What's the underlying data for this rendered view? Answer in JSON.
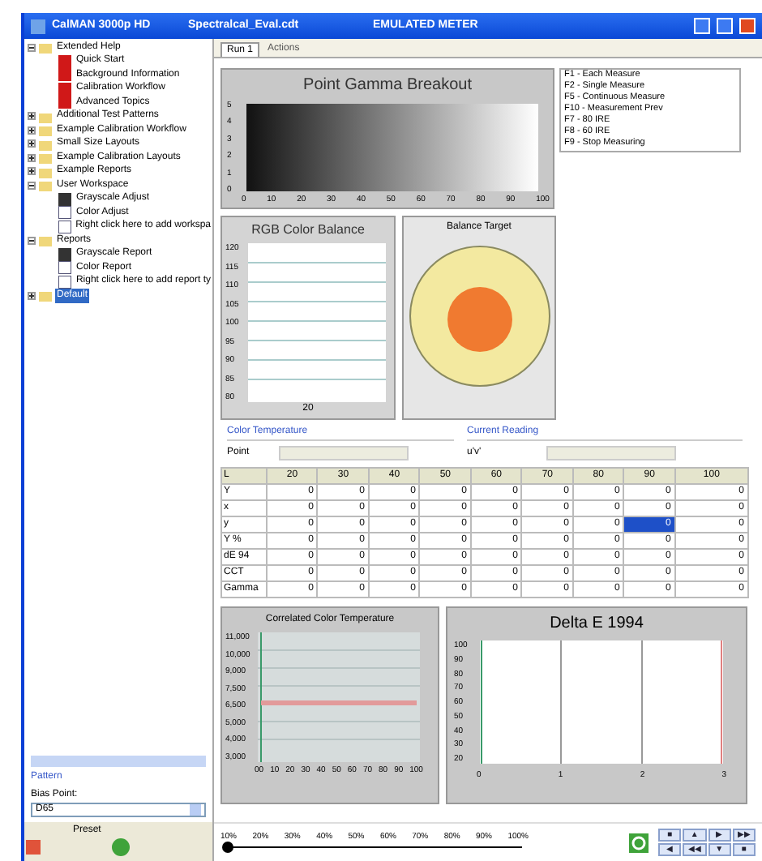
{
  "window": {
    "title": "CalMAN 3000p HD",
    "file": "Spectralcal_Eval.cdt",
    "meter": "EMULATED METER"
  },
  "tree": [
    {
      "label": "Extended Help",
      "kind": "folder",
      "expanded": true,
      "selected": false,
      "children": [
        {
          "label": "Quick Start",
          "kind": "book",
          "selected": false
        },
        {
          "label": "Background Information",
          "kind": "book",
          "selected": false
        },
        {
          "label": "Calibration Workflow",
          "kind": "book",
          "selected": false
        },
        {
          "label": "Advanced Topics",
          "kind": "book",
          "selected": false
        }
      ]
    },
    {
      "label": "Additional Test Patterns",
      "kind": "folder",
      "expanded": false,
      "selected": false
    },
    {
      "label": "Example Calibration Workflow",
      "kind": "folder",
      "expanded": false,
      "selected": false
    },
    {
      "label": "Small Size Layouts",
      "kind": "folder",
      "expanded": false,
      "selected": false
    },
    {
      "label": "Example Calibration Layouts",
      "kind": "folder",
      "expanded": false,
      "selected": false
    },
    {
      "label": "Example Reports",
      "kind": "folder",
      "expanded": false,
      "selected": false
    },
    {
      "label": "User Workspace",
      "kind": "folder",
      "expanded": true,
      "selected": false,
      "children": [
        {
          "label": "Grayscale Adjust",
          "kind": "sheet",
          "selected": false
        },
        {
          "label": "Color Adjust",
          "kind": "document",
          "selected": false
        },
        {
          "label": "Right click here to add workspa",
          "kind": "document",
          "selected": false
        }
      ]
    },
    {
      "label": "Reports",
      "kind": "folder",
      "expanded": true,
      "selected": false,
      "children": [
        {
          "label": "Grayscale Report",
          "kind": "sheet",
          "selected": false
        },
        {
          "label": "Color Report",
          "kind": "document",
          "selected": false
        },
        {
          "label": "Right click here to add report ty",
          "kind": "document",
          "selected": false
        }
      ]
    },
    {
      "label": "Default",
      "kind": "folder",
      "expanded": false,
      "selected": true
    }
  ],
  "sidebar_bottom": {
    "pattern_link": "Pattern",
    "bias_label": "Bias Point:",
    "bias_value": "D65",
    "footer_label": "Preset"
  },
  "tabs": [
    {
      "label": "Run 1",
      "selected": true
    },
    {
      "label": "Actions",
      "selected": false
    }
  ],
  "gamma": {
    "title": "Point Gamma Breakout",
    "yticks": [
      "5",
      "4",
      "3",
      "2",
      "1",
      "0"
    ],
    "xticks": [
      "0",
      "10",
      "20",
      "30",
      "40",
      "50",
      "60",
      "70",
      "80",
      "90",
      "100"
    ]
  },
  "shortcuts": [
    "F1 - Each Measure",
    "F2 - Single Measure",
    "F5 - Continuous Measure",
    "F10 - Measurement Prev",
    "F7 - 80 IRE",
    "F8 - 60 IRE",
    "F9 - Stop Measuring"
  ],
  "rgb": {
    "title": "RGB Color Balance",
    "yticks": [
      "120",
      "115",
      "110",
      "105",
      "100",
      "95",
      "90",
      "85",
      "80"
    ],
    "xtick": "20"
  },
  "target": {
    "title": "Balance Target"
  },
  "color_temp": {
    "label": "Color Temperature",
    "field_label": "Point"
  },
  "current": {
    "label": "Current Reading",
    "field_label": "u'v'"
  },
  "table": {
    "columns": [
      "L",
      "20",
      "30",
      "40",
      "50",
      "60",
      "70",
      "80",
      "90",
      "100"
    ],
    "rows": [
      {
        "cells": [
          {
            "v": "Y",
            "selected": false
          },
          {
            "v": "0",
            "selected": false
          },
          {
            "v": "0",
            "selected": false
          },
          {
            "v": "0",
            "selected": false
          },
          {
            "v": "0",
            "selected": false
          },
          {
            "v": "0",
            "selected": false
          },
          {
            "v": "0",
            "selected": false
          },
          {
            "v": "0",
            "selected": false
          },
          {
            "v": "0",
            "selected": false
          },
          {
            "v": "0",
            "selected": false
          }
        ]
      },
      {
        "cells": [
          {
            "v": "x",
            "selected": false
          },
          {
            "v": "0",
            "selected": false
          },
          {
            "v": "0",
            "selected": false
          },
          {
            "v": "0",
            "selected": false
          },
          {
            "v": "0",
            "selected": false
          },
          {
            "v": "0",
            "selected": false
          },
          {
            "v": "0",
            "selected": false
          },
          {
            "v": "0",
            "selected": false
          },
          {
            "v": "0",
            "selected": false
          },
          {
            "v": "0",
            "selected": false
          }
        ]
      },
      {
        "cells": [
          {
            "v": "y",
            "selected": false
          },
          {
            "v": "0",
            "selected": false
          },
          {
            "v": "0",
            "selected": false
          },
          {
            "v": "0",
            "selected": false
          },
          {
            "v": "0",
            "selected": false
          },
          {
            "v": "0",
            "selected": false
          },
          {
            "v": "0",
            "selected": false
          },
          {
            "v": "0",
            "selected": false
          },
          {
            "v": "0",
            "selected": true
          },
          {
            "v": "0",
            "selected": false
          }
        ]
      },
      {
        "cells": [
          {
            "v": "Y %",
            "selected": false
          },
          {
            "v": "0",
            "selected": false
          },
          {
            "v": "0",
            "selected": false
          },
          {
            "v": "0",
            "selected": false
          },
          {
            "v": "0",
            "selected": false
          },
          {
            "v": "0",
            "selected": false
          },
          {
            "v": "0",
            "selected": false
          },
          {
            "v": "0",
            "selected": false
          },
          {
            "v": "0",
            "selected": false
          },
          {
            "v": "0",
            "selected": false
          }
        ]
      },
      {
        "cells": [
          {
            "v": "dE 94",
            "selected": false
          },
          {
            "v": "0",
            "selected": false
          },
          {
            "v": "0",
            "selected": false
          },
          {
            "v": "0",
            "selected": false
          },
          {
            "v": "0",
            "selected": false
          },
          {
            "v": "0",
            "selected": false
          },
          {
            "v": "0",
            "selected": false
          },
          {
            "v": "0",
            "selected": false
          },
          {
            "v": "0",
            "selected": false
          },
          {
            "v": "0",
            "selected": false
          }
        ]
      },
      {
        "cells": [
          {
            "v": "CCT",
            "selected": false
          },
          {
            "v": "0",
            "selected": false
          },
          {
            "v": "0",
            "selected": false
          },
          {
            "v": "0",
            "selected": false
          },
          {
            "v": "0",
            "selected": false
          },
          {
            "v": "0",
            "selected": false
          },
          {
            "v": "0",
            "selected": false
          },
          {
            "v": "0",
            "selected": false
          },
          {
            "v": "0",
            "selected": false
          },
          {
            "v": "0",
            "selected": false
          }
        ]
      },
      {
        "cells": [
          {
            "v": "Gamma",
            "selected": false
          },
          {
            "v": "0",
            "selected": false
          },
          {
            "v": "0",
            "selected": false
          },
          {
            "v": "0",
            "selected": false
          },
          {
            "v": "0",
            "selected": false
          },
          {
            "v": "0",
            "selected": false
          },
          {
            "v": "0",
            "selected": false
          },
          {
            "v": "0",
            "selected": false
          },
          {
            "v": "0",
            "selected": false
          },
          {
            "v": "0",
            "selected": false
          }
        ]
      }
    ]
  },
  "cct": {
    "title": "Correlated Color Temperature",
    "yticks": [
      "11,000",
      "10,000",
      "9,000",
      "7,500",
      "6,500",
      "5,000",
      "4,000",
      "3,000"
    ],
    "xticks": [
      "00",
      "10",
      "20",
      "30",
      "40",
      "50",
      "60",
      "70",
      "80",
      "90",
      "100"
    ]
  },
  "delta": {
    "title": "Delta E 1994",
    "yticks": [
      "100",
      "90",
      "80",
      "70",
      "60",
      "50",
      "40",
      "30",
      "20"
    ],
    "xticks": [
      "0",
      "1",
      "2",
      "3"
    ]
  },
  "slider": {
    "level": 0,
    "labels": [
      "10%",
      "20%",
      "30%",
      "40%",
      "50%",
      "60%",
      "70%",
      "80%",
      "90%",
      "100%"
    ]
  },
  "nav_buttons": [
    "■",
    "▲",
    "▶",
    "▶▶",
    "◀",
    "◀◀",
    "▼",
    "■"
  ]
}
